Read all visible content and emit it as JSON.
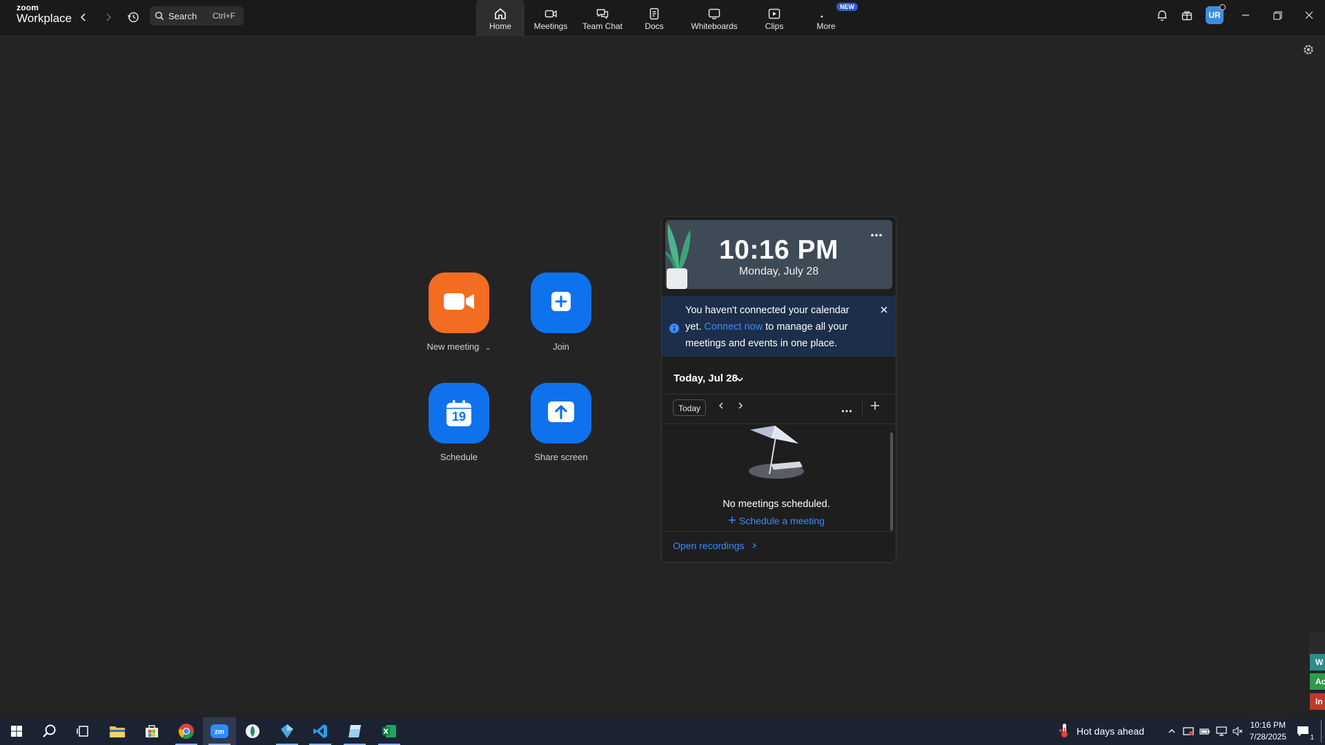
{
  "app": {
    "logo_top": "zoom",
    "logo_bottom": "Workplace"
  },
  "search": {
    "label": "Search",
    "shortcut": "Ctrl+F"
  },
  "tabs": [
    {
      "label": "Home",
      "icon": "home-icon"
    },
    {
      "label": "Meetings",
      "icon": "video-icon"
    },
    {
      "label": "Team Chat",
      "icon": "chat-icon"
    },
    {
      "label": "Docs",
      "icon": "doc-icon"
    },
    {
      "label": "Whiteboards",
      "icon": "whiteboard-icon"
    },
    {
      "label": "Clips",
      "icon": "clips-icon"
    },
    {
      "label": "More",
      "icon": "more-icon",
      "badge": "NEW"
    }
  ],
  "user": {
    "initials": "UR"
  },
  "actions": {
    "new_meeting": "New meeting",
    "join": "Join",
    "schedule": "Schedule",
    "schedule_day": "19",
    "share_screen": "Share screen"
  },
  "widget": {
    "time": "10:16 PM",
    "date": "Monday, July 28",
    "notice_pre": "You haven't connected your calendar yet.",
    "notice_link": "Connect now",
    "notice_post": "to manage all your meetings and events in one place.",
    "day_header": "Today, Jul 28",
    "today_button": "Today",
    "empty_text": "No meetings scheduled.",
    "schedule_link": "Schedule a meeting",
    "open_recordings": "Open recordings"
  },
  "edge_labels": [
    "W",
    "Ac",
    "In"
  ],
  "taskbar": {
    "weather": "Hot days ahead",
    "time": "10:16 PM",
    "date": "7/28/2025",
    "notifications": "1"
  },
  "colors": {
    "accent_blue": "#0e72ed",
    "accent_orange": "#f26d21",
    "link": "#3d8bfd",
    "background": "#242424"
  }
}
